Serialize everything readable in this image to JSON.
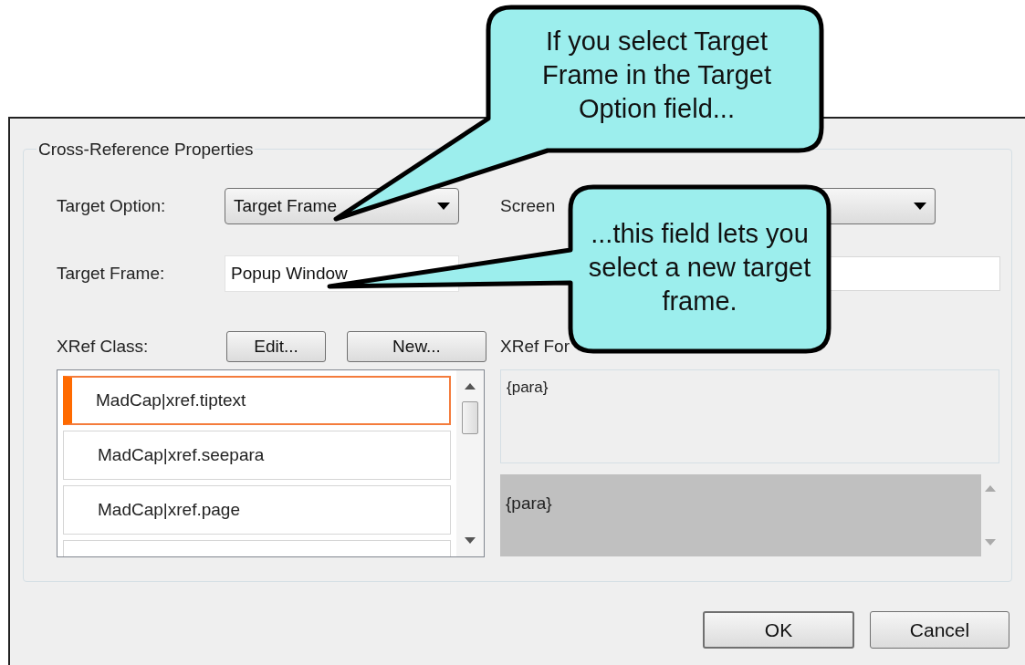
{
  "dialog": {
    "group_title": "Cross-Reference Properties",
    "target_option": {
      "label": "Target Option:",
      "value": "Target Frame"
    },
    "screen": {
      "label": "Screen"
    },
    "target_frame": {
      "label": "Target Frame:",
      "value": "Popup Window"
    },
    "xref_class": {
      "label": "XRef Class:",
      "buttons": [
        "Edit...",
        "New..."
      ],
      "items": [
        {
          "label": "MadCap|xref.tiptext",
          "selected": true
        },
        {
          "label": "MadCap|xref.seepara",
          "selected": false
        },
        {
          "label": "MadCap|xref.page",
          "selected": false
        }
      ]
    },
    "xref_format": {
      "label": "XRef For",
      "value": "{para}",
      "preview": "{para}"
    },
    "buttons": [
      {
        "label": "OK",
        "default": true
      },
      {
        "label": "Cancel",
        "default": false
      }
    ]
  },
  "callouts": [
    {
      "text": "If you select Target Frame in the Target Option field..."
    },
    {
      "text": "...this field lets you select a new target frame."
    }
  ]
}
